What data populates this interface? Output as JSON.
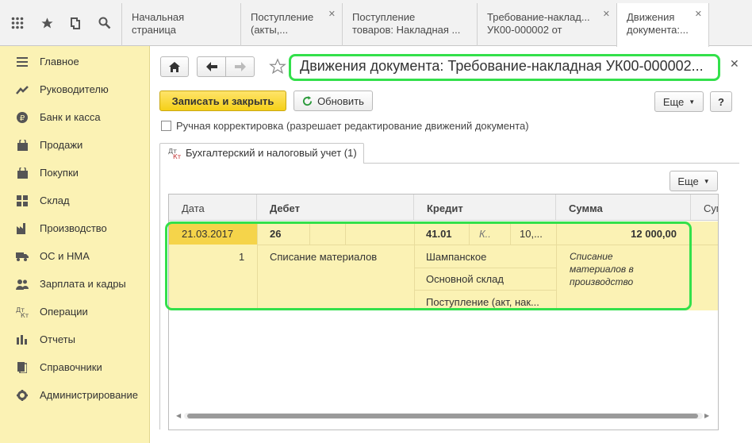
{
  "topbar": {
    "tabs": [
      {
        "label": "Начальная страница"
      },
      {
        "line1": "Поступление",
        "line2": "(акты,..."
      },
      {
        "line1": "Поступление",
        "line2": "товаров: Накладная ..."
      },
      {
        "line1": "Требование-наклад...",
        "line2": "УК00-000002 от"
      },
      {
        "line1": "Движения",
        "line2": "документа:..."
      }
    ]
  },
  "sidebar": {
    "items": [
      {
        "label": "Главное",
        "icon": "menu-icon"
      },
      {
        "label": "Руководителю",
        "icon": "trend-icon"
      },
      {
        "label": "Банк и касса",
        "icon": "ruble-icon"
      },
      {
        "label": "Продажи",
        "icon": "bag-icon"
      },
      {
        "label": "Покупки",
        "icon": "cart-icon"
      },
      {
        "label": "Склад",
        "icon": "warehouse-icon"
      },
      {
        "label": "Производство",
        "icon": "factory-icon"
      },
      {
        "label": "ОС и НМА",
        "icon": "truck-icon"
      },
      {
        "label": "Зарплата и кадры",
        "icon": "people-icon"
      },
      {
        "label": "Операции",
        "icon": "dt-kt-icon"
      },
      {
        "label": "Отчеты",
        "icon": "bar-chart-icon"
      },
      {
        "label": "Справочники",
        "icon": "books-icon"
      },
      {
        "label": "Администрирование",
        "icon": "gear-icon"
      }
    ]
  },
  "header": {
    "title": "Движения документа: Требование-накладная УК00-000002..."
  },
  "toolbar": {
    "save_close": "Записать и закрыть",
    "refresh": "Обновить",
    "more": "Еще",
    "help": "?"
  },
  "manual": {
    "label": "Ручная корректировка (разрешает редактирование движений документа)"
  },
  "tab": {
    "label": "Бухгалтерский и налоговый учет (1)",
    "more": "Еще"
  },
  "table": {
    "headers": {
      "date": "Дата",
      "debit": "Дебет",
      "credit": "Кредит",
      "sum": "Сумма",
      "extra": "Сум"
    },
    "row": {
      "date": "21.03.2017",
      "num": "1",
      "debit_account": "26",
      "debit_text": "Списание материалов",
      "credit_account": "41.01",
      "credit_k": "К..",
      "credit_qty": "10,...",
      "credit_sub1": "Шампанское",
      "credit_sub2": "Основной склад",
      "credit_sub3": "Поступление (акт, нак...",
      "sum": "12 000,00",
      "sum_text": "Списание материалов в производство"
    }
  }
}
